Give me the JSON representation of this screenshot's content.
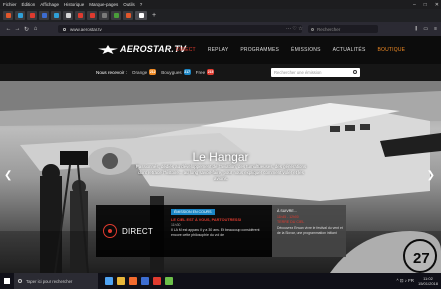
{
  "browser": {
    "menu": [
      "Fichier",
      "Édition",
      "Affichage",
      "Historique",
      "Marque-pages",
      "Outils",
      "?"
    ],
    "window_controls": [
      "–",
      "□",
      "✕"
    ],
    "tabs": [
      {
        "color": "#e2572b",
        "active": false
      },
      {
        "color": "#2fa0d8",
        "active": false
      },
      {
        "color": "#e03b2f",
        "active": false
      },
      {
        "color": "#3d6dd1",
        "active": false
      },
      {
        "color": "#2fa0d8",
        "active": false
      },
      {
        "color": "#d6d6d6",
        "active": false
      },
      {
        "color": "#e03b2f",
        "active": false
      },
      {
        "color": "#e03b2f",
        "active": false
      },
      {
        "color": "#7a7a7a",
        "active": false
      },
      {
        "color": "#4a9e3a",
        "active": false
      },
      {
        "color": "#e2572b",
        "active": false
      },
      {
        "color": "#ffffff",
        "active": true
      }
    ],
    "new_tab": "+",
    "nav": {
      "back": "←",
      "forward": "→",
      "reload": "↻",
      "home": "⌂"
    },
    "url": "www.aerostar.tv",
    "url_actions": "··· ♡ ☆",
    "search_placeholder": "Rechercher",
    "right_icons": [
      "⫼",
      "▭",
      "≡"
    ]
  },
  "site": {
    "logo": "AEROSTAR.TV",
    "nav": [
      "DIRECT",
      "REPLAY",
      "PROGRAMMES",
      "ÉMISSIONS",
      "ACTUALITÉS",
      "BOUTIQUE"
    ],
    "receive_label": "Nous recevoir :",
    "channels": [
      {
        "name": "Orange",
        "num": "212",
        "color": "#f08a24"
      },
      {
        "name": "Bouygues",
        "num": "217",
        "color": "#1a86c6"
      },
      {
        "name": "Free",
        "num": "215",
        "color": "#e03b2f"
      }
    ],
    "search_placeholder": "Rechercher une émission"
  },
  "hero": {
    "title": "Le Hangar",
    "subtitle": "Passionnés, dédiés au développement de l'aviation, des tumultueuses, des générations dont retrace l'histoire... au long savoir-faire, pour nous expliquer comment voler et les avions.",
    "number": "27"
  },
  "direct": {
    "label": "DIRECT",
    "tag": "ÉMISSION EN COURS",
    "title": "LE CIEL EST À VOUS, PARTOUTRESSI",
    "time": "11h30",
    "desc": "Il LA M est apparu il y a 30 ans. Et beaucoup considèrent encore cette philosophie du vol de"
  },
  "next": {
    "tag": "À SUIVRE...",
    "time": "11h45 - 12h00",
    "title": "TERRE DU CIEL",
    "desc": "Découvrez Erwan vivre le festival du vent et de la Slovar, une programmation initiant"
  },
  "taskbar": {
    "search_placeholder": "Taper ici pour rechercher",
    "apps": [
      "#4fa3f2",
      "#e8b63a",
      "#f26b2e",
      "#3d6dd1",
      "#e03b2f",
      "#6cc04a"
    ],
    "tray": "^ ⊡ ♪ FR",
    "time": "11:02",
    "date": "15/01/2018"
  }
}
